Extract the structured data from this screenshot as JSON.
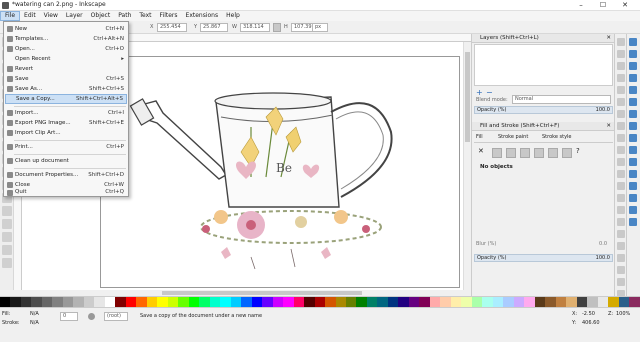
{
  "window": {
    "title": "*watering can 2.png - Inkscape",
    "controls": [
      "–",
      "☐",
      "✕"
    ]
  },
  "menubar": [
    "File",
    "Edit",
    "View",
    "Layer",
    "Object",
    "Path",
    "Text",
    "Filters",
    "Extensions",
    "Help"
  ],
  "toolcontrols": {
    "x_label": "X",
    "x_value": "255.454",
    "y_label": "Y",
    "y_value": "25.867",
    "w_label": "W",
    "w_value": "318.114",
    "h_label": "H",
    "h_value": "107.391",
    "unit": "px"
  },
  "file_menu": [
    {
      "label": "New",
      "shortcut": "Ctrl+N"
    },
    {
      "label": "Templates...",
      "shortcut": "Ctrl+Alt+N"
    },
    {
      "label": "Open...",
      "shortcut": "Ctrl+O"
    },
    {
      "label": "Open Recent",
      "shortcut": "▸"
    },
    {
      "label": "Revert",
      "shortcut": ""
    },
    {
      "label": "Save",
      "shortcut": "Ctrl+S"
    },
    {
      "label": "Save As...",
      "shortcut": "Shift+Ctrl+S"
    },
    {
      "label": "Save a Copy...",
      "shortcut": "Shift+Ctrl+Alt+S"
    },
    {
      "label": "Import...",
      "shortcut": "Ctrl+I"
    },
    {
      "label": "Export PNG Image...",
      "shortcut": "Shift+Ctrl+E"
    },
    {
      "label": "Import Clip Art...",
      "shortcut": ""
    },
    {
      "label": "Print...",
      "shortcut": "Ctrl+P"
    },
    {
      "label": "Clean up document",
      "shortcut": ""
    },
    {
      "label": "Document Properties...",
      "shortcut": "Shift+Ctrl+D"
    },
    {
      "label": "Close",
      "shortcut": "Ctrl+W"
    },
    {
      "label": "Quit",
      "shortcut": "Ctrl+Q"
    }
  ],
  "layers_panel": {
    "title": "Layers (Shift+Ctrl+L)",
    "blend_mode_label": "Blend mode:",
    "blend_mode_value": "Normal",
    "opacity_label": "Opacity (%)",
    "opacity_value": "100.0"
  },
  "fill_panel": {
    "title": "Fill and Stroke (Shift+Ctrl+F)",
    "tabs": [
      "Fill",
      "Stroke paint",
      "Stroke style"
    ],
    "status": "No objects",
    "blur_label": "Blur (%)",
    "blur_value": "0.0",
    "opacity_label": "Opacity (%)",
    "opacity_value": "100.0"
  },
  "status": {
    "fill_label": "Fill:",
    "fill_value": "N/A",
    "stroke_label": "Stroke:",
    "stroke_value": "N/A",
    "opacity_value": "0",
    "layer_value": "(root)",
    "message": "Save a copy of the document under a new name",
    "x_label": "X:",
    "x_value": "-2.50",
    "y_label": "Y:",
    "y_value": "406.60",
    "zoom_label": "Z:",
    "zoom_value": "100%"
  },
  "palette_colors": [
    "#000000",
    "#1a1a1a",
    "#333333",
    "#4d4d4d",
    "#666666",
    "#808080",
    "#999999",
    "#b3b3b3",
    "#cccccc",
    "#e6e6e6",
    "#ffffff",
    "#800000",
    "#ff0000",
    "#ff6600",
    "#ffcc00",
    "#ffff00",
    "#ccff00",
    "#66ff00",
    "#00ff00",
    "#00ff66",
    "#00ffcc",
    "#00ffff",
    "#00ccff",
    "#0066ff",
    "#0000ff",
    "#6600ff",
    "#cc00ff",
    "#ff00ff",
    "#ff0066",
    "#550000",
    "#aa0000",
    "#d45500",
    "#aa8800",
    "#668000",
    "#008000",
    "#008066",
    "#006680",
    "#003380",
    "#220080",
    "#660080",
    "#800055",
    "#ffaaaa",
    "#ffccaa",
    "#ffeeaa",
    "#eeffaa",
    "#aaffaa",
    "#aaffee",
    "#aaeeff",
    "#aaccff",
    "#ccaaff",
    "#ffaaee",
    "#5a3a1a",
    "#8b5a2b",
    "#c08040",
    "#e0b070",
    "#404040",
    "#c0c0c0",
    "#e8e8e8",
    "#d4aa00",
    "#2b5f8a",
    "#8a2b5f"
  ],
  "annotation": {
    "arrow_color": "#e00000"
  }
}
